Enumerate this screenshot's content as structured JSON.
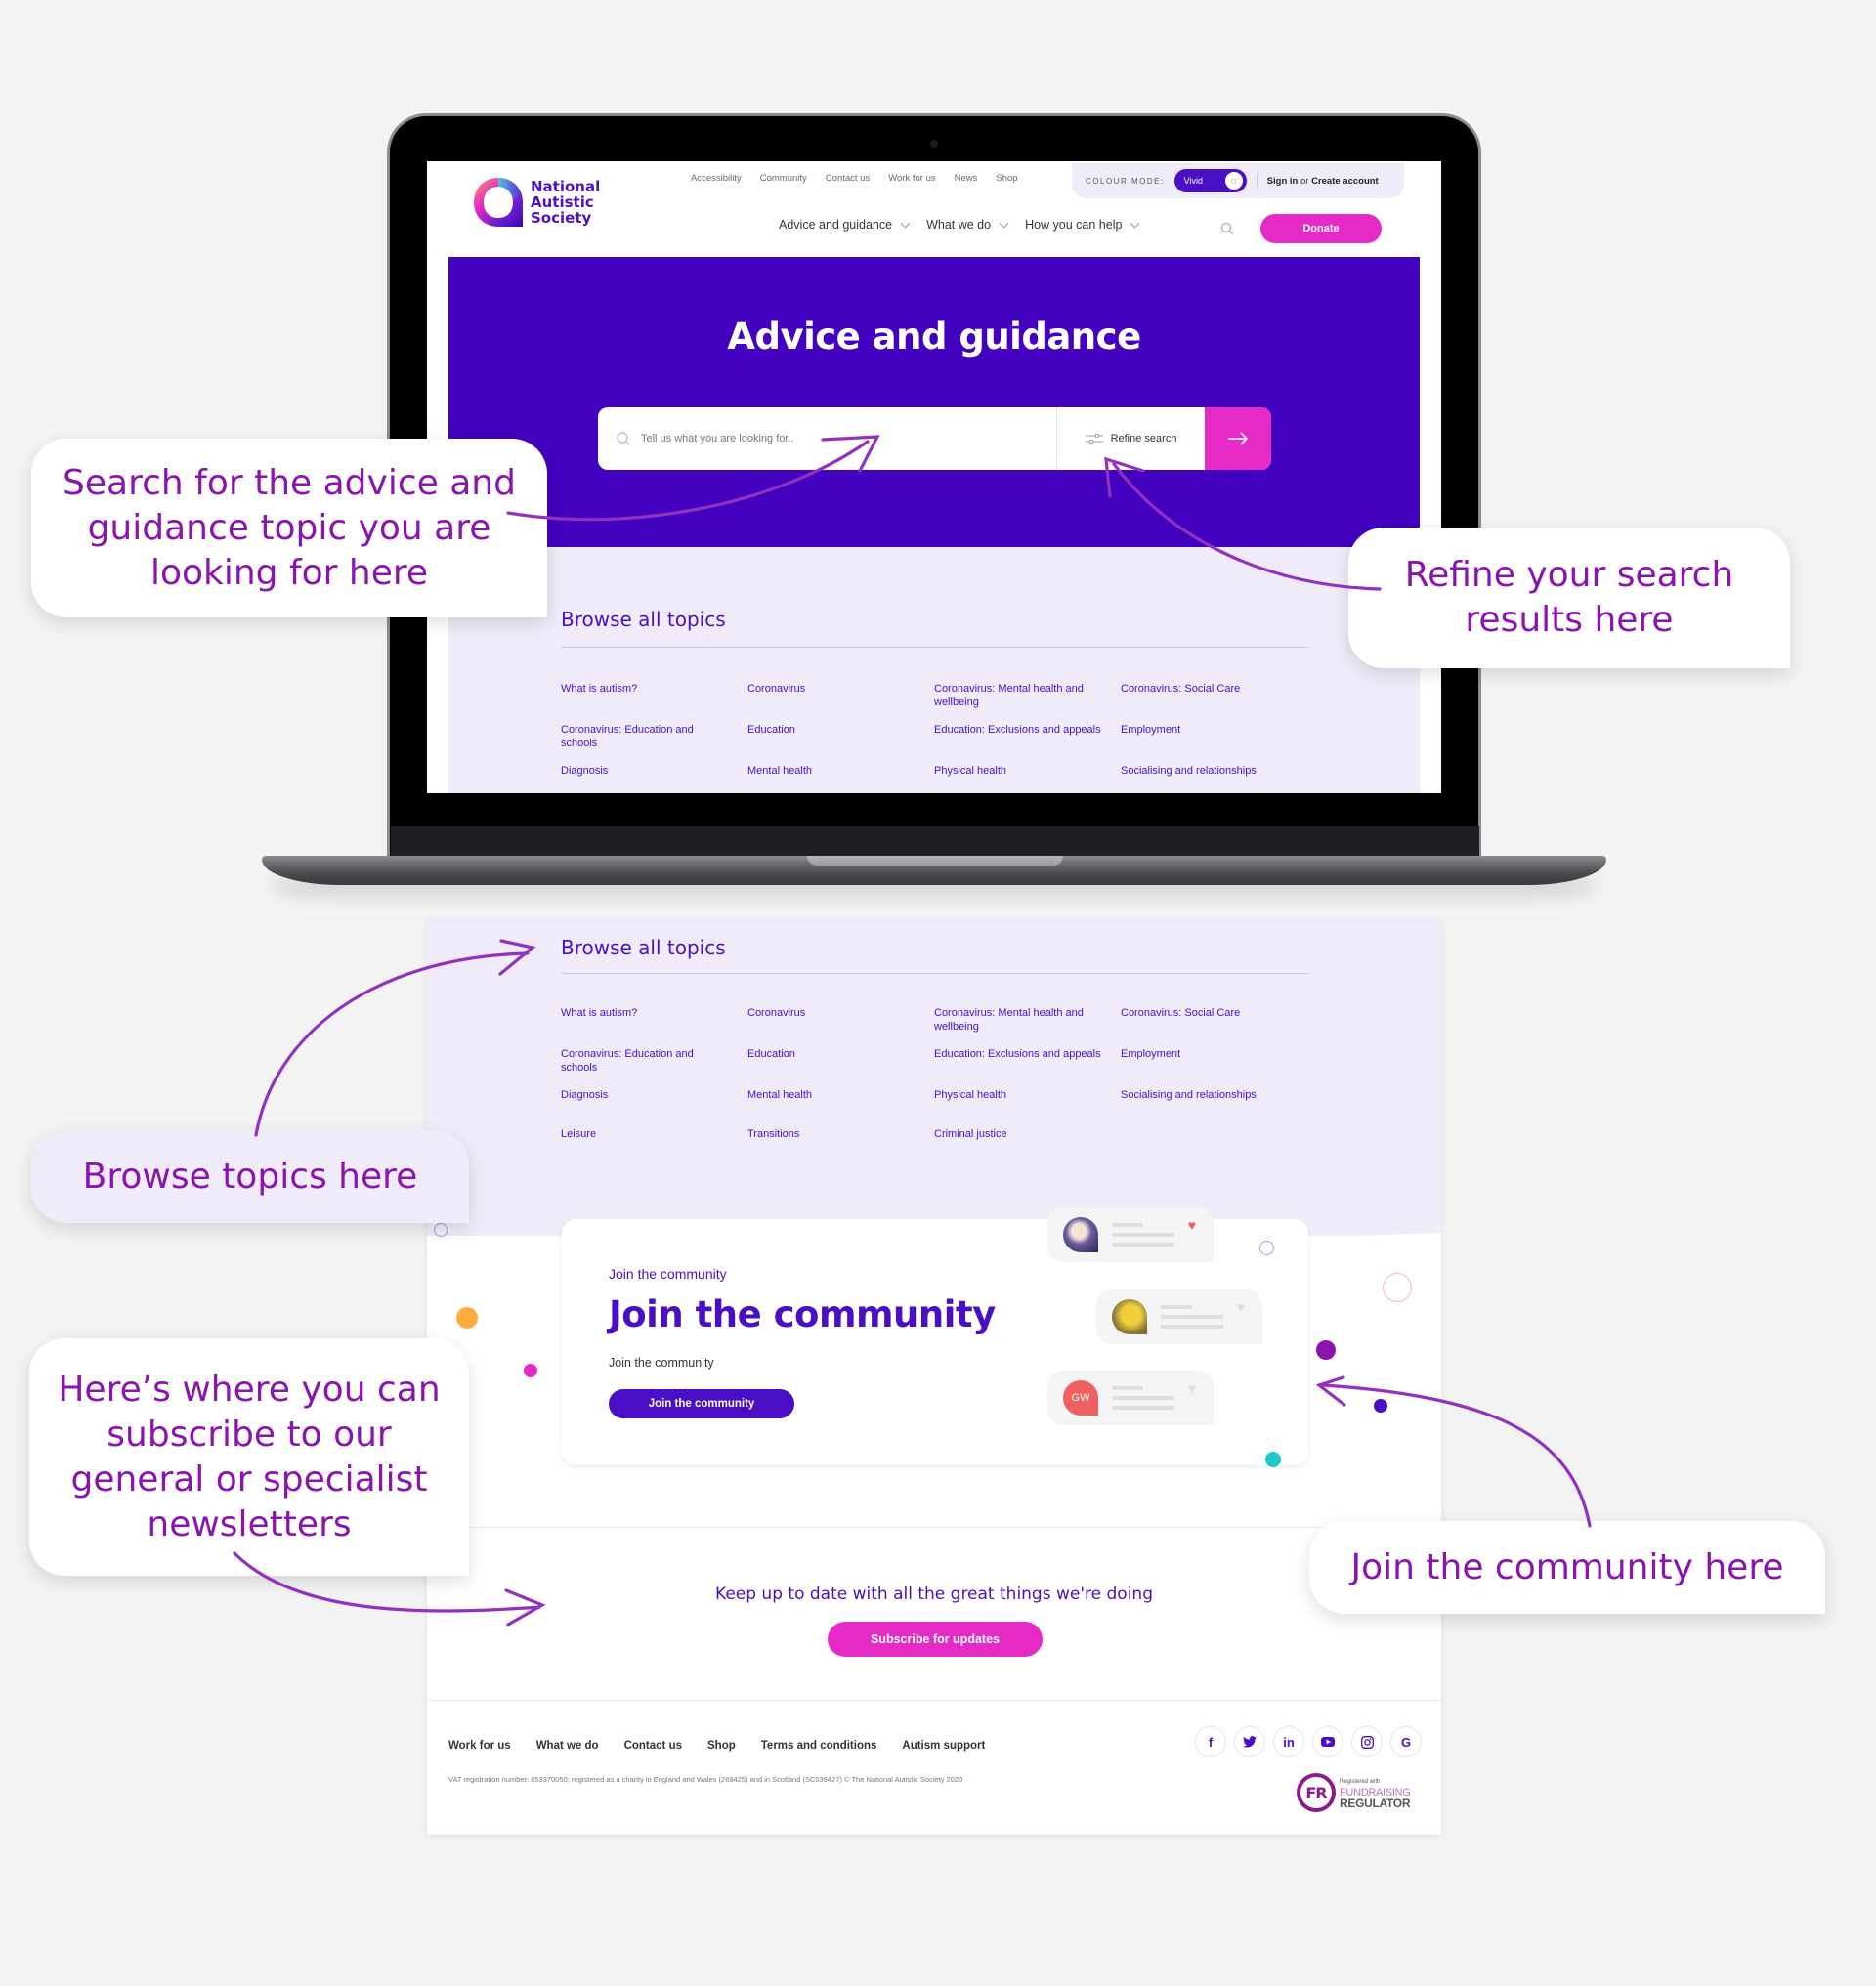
{
  "header": {
    "logo": {
      "line1": "National",
      "line2": "Autistic",
      "line3": "Society"
    },
    "utility_links": [
      "Accessibility",
      "Community",
      "Contact us",
      "Work for us",
      "News",
      "Shop"
    ],
    "colour_mode_label": "COLOUR MODE:",
    "colour_mode_value": "Vivid",
    "sign_in": "Sign in",
    "or": "or",
    "create_account": "Create account",
    "main_nav": [
      "Advice and guidance",
      "What we do",
      "How you can help"
    ],
    "donate": "Donate"
  },
  "hero": {
    "title": "Advice and guidance",
    "search_placeholder": "Tell us what you are looking for..",
    "refine_label": "Refine search"
  },
  "topics": {
    "title": "Browse all topics",
    "items": [
      "What is autism?",
      "Coronavirus",
      "Coronavirus: Mental health and wellbeing",
      "Coronavirus: Social Care",
      "Coronavirus: Education and schools",
      "Education",
      "Education: Exclusions and appeals",
      "Employment",
      "Diagnosis",
      "Mental health",
      "Physical health",
      "Socialising and relationships",
      "Leisure",
      "Transitions",
      "Criminal justice"
    ]
  },
  "community": {
    "eyebrow": "Join the community",
    "title": "Join the community",
    "subtitle": "Join the community",
    "button": "Join the community",
    "avatar_initials": "GW"
  },
  "newsletter": {
    "text": "Keep up to date with all the great things we're doing",
    "button": "Subscribe for updates"
  },
  "footer": {
    "links": [
      "Work for us",
      "What we do",
      "Contact us",
      "Shop",
      "Terms and conditions",
      "Autism support"
    ],
    "legal": "VAT registration number: 653370050; registered as a charity in England and Wales (269425) and in Scotland (SC039427) © The National Autistic Society 2020",
    "social": [
      "facebook",
      "twitter",
      "linkedin",
      "youtube",
      "instagram",
      "google"
    ],
    "fr_badge": {
      "initials": "FR",
      "line1": "Registered with",
      "line2": "FUNDRAISING",
      "line3": "REGULATOR"
    }
  },
  "callouts": {
    "search": "Search for the advice and guidance topic you are looking for here",
    "refine": "Refine your search results here",
    "browse": "Browse topics here",
    "subscribe": "Here’s where you can subscribe to our general or specialist newsletters",
    "community": "Join the community here"
  },
  "colors": {
    "brand_purple": "#4202bf",
    "brand_pink": "#e62ac6",
    "lavender": "#efebf8",
    "callout_text": "#8a14b0"
  }
}
